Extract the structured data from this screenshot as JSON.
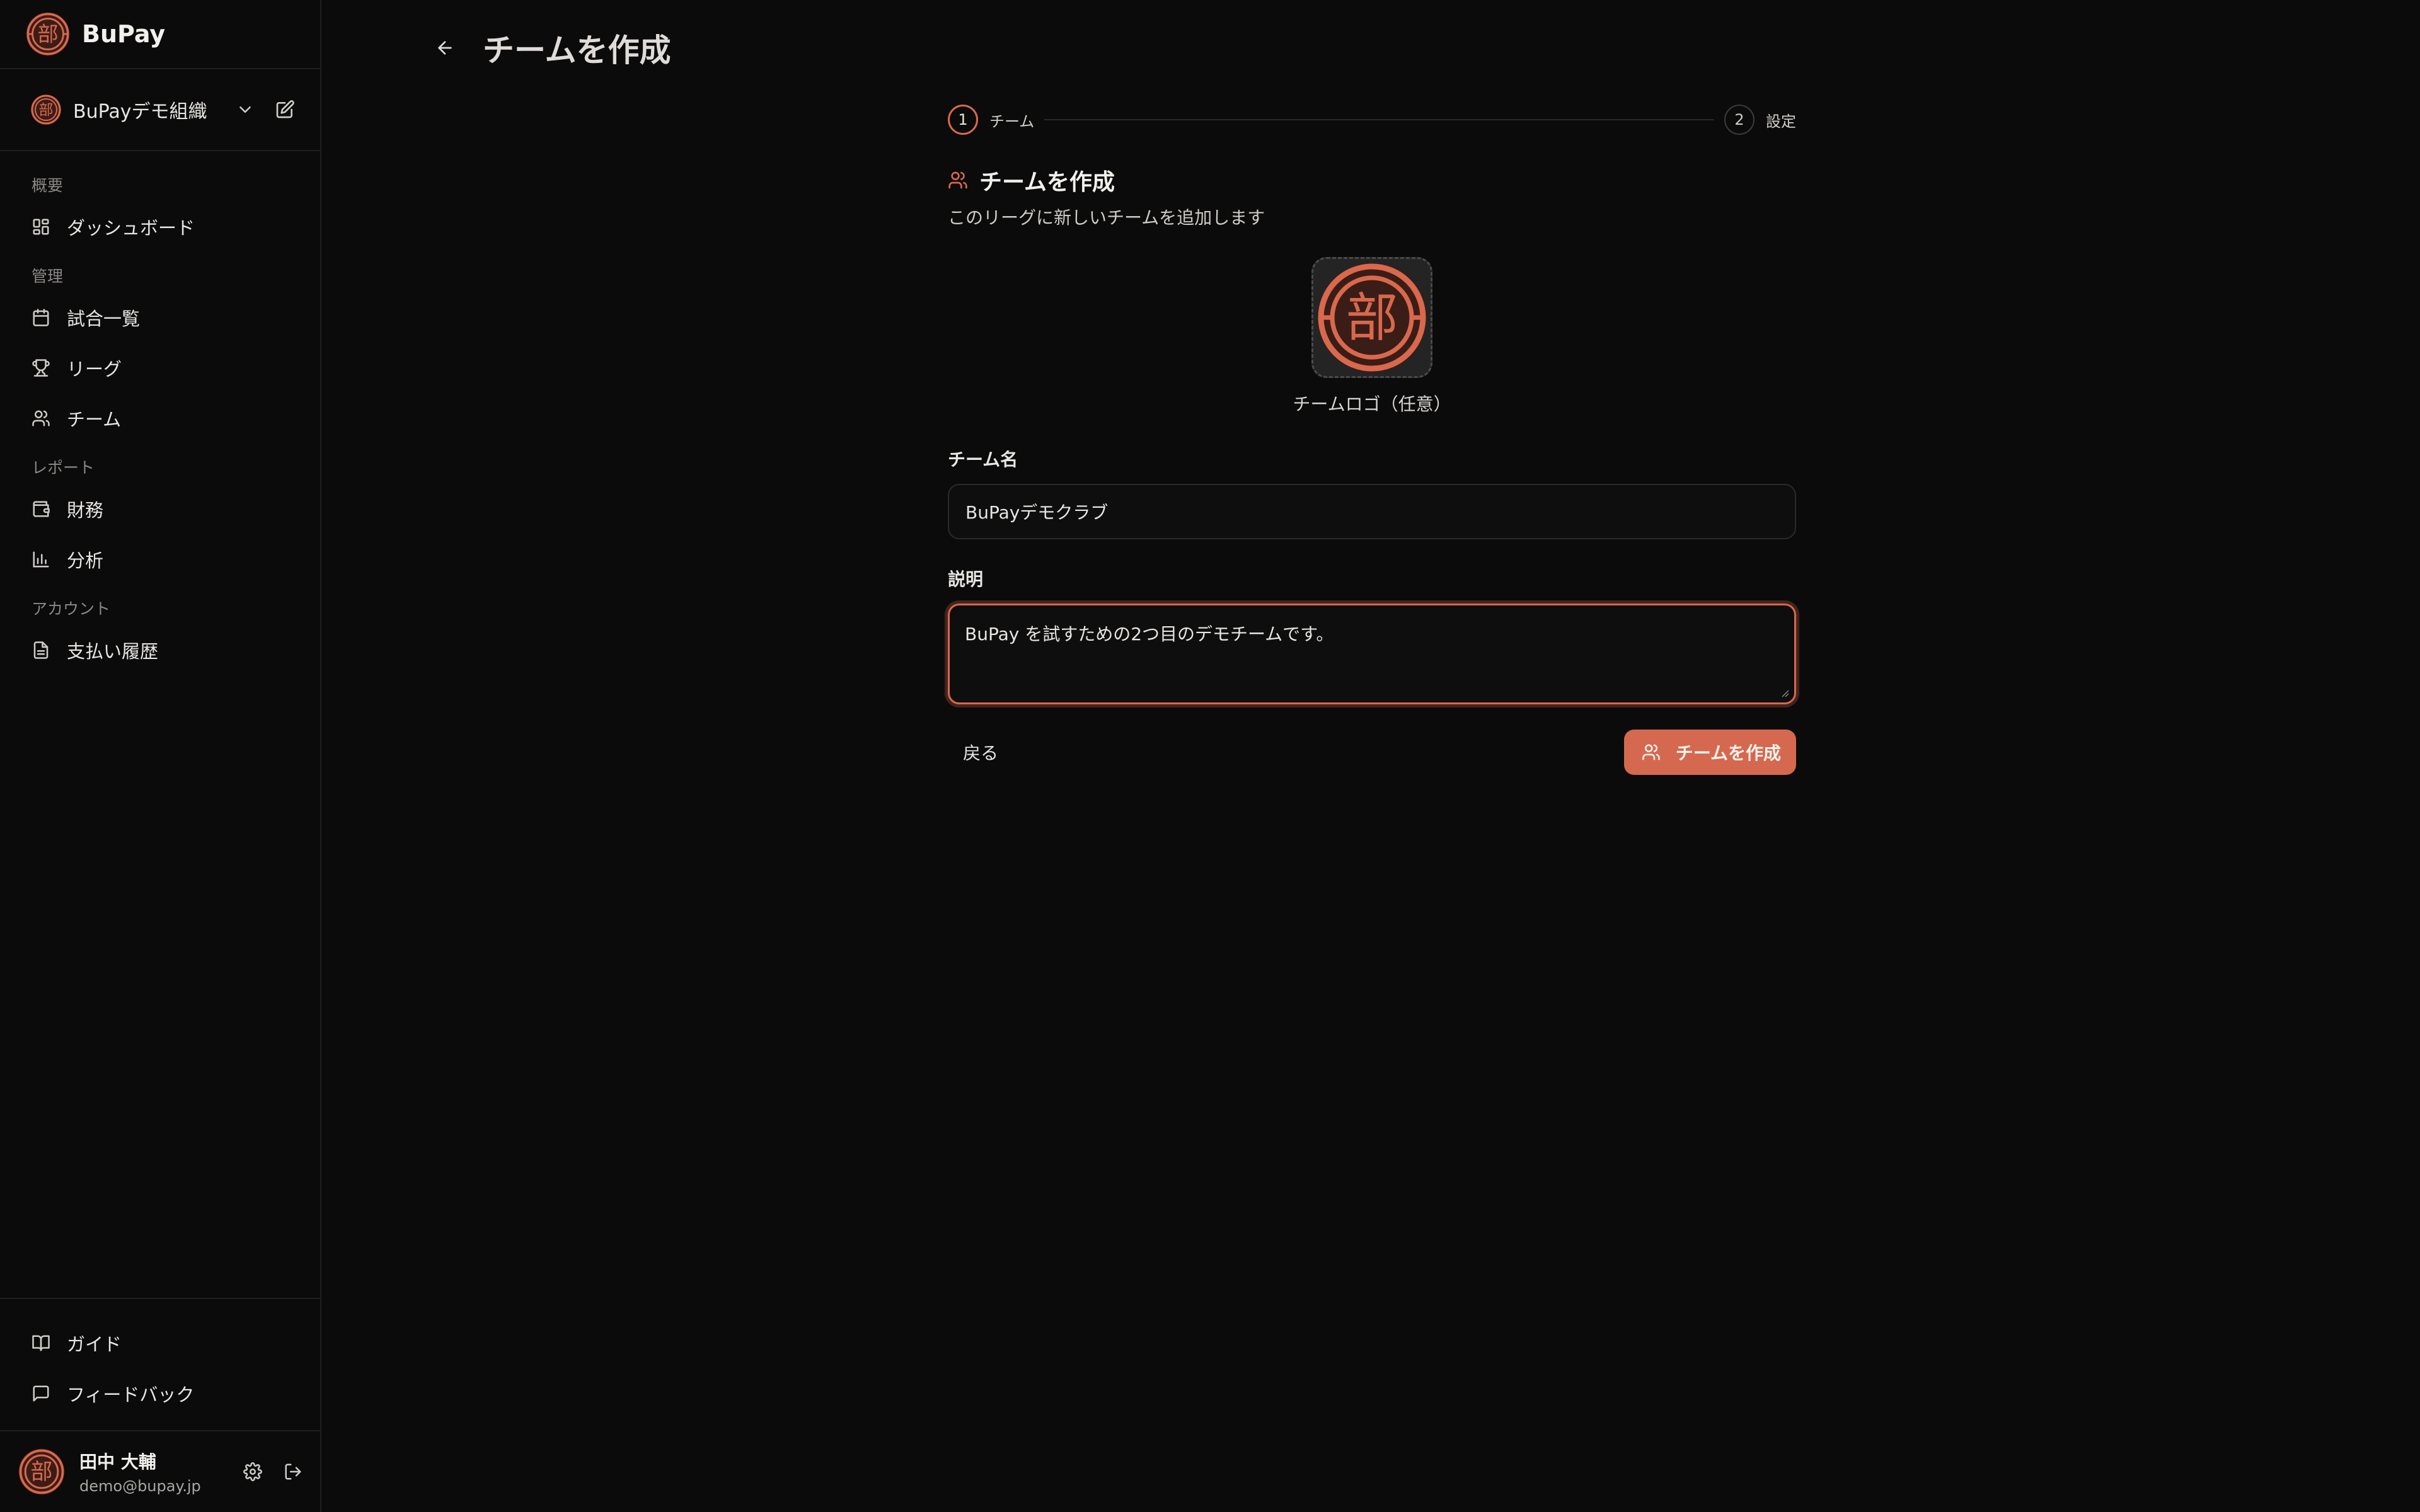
{
  "brand": {
    "name": "BuPay",
    "seal_glyph": "部"
  },
  "org": {
    "name": "BuPayデモ組織"
  },
  "nav": {
    "sections": [
      {
        "title": "概要",
        "items": [
          {
            "label": "ダッシュボード",
            "icon": "dashboard-grid-icon"
          }
        ]
      },
      {
        "title": "管理",
        "items": [
          {
            "label": "試合一覧",
            "icon": "calendar-icon"
          },
          {
            "label": "リーグ",
            "icon": "trophy-icon"
          },
          {
            "label": "チーム",
            "icon": "users-icon"
          }
        ]
      },
      {
        "title": "レポート",
        "items": [
          {
            "label": "財務",
            "icon": "wallet-icon"
          },
          {
            "label": "分析",
            "icon": "bar-chart-icon"
          }
        ]
      },
      {
        "title": "アカウント",
        "items": [
          {
            "label": "支払い履歴",
            "icon": "document-icon"
          }
        ]
      }
    ],
    "bottom": [
      {
        "label": "ガイド",
        "icon": "book-icon"
      },
      {
        "label": "フィードバック",
        "icon": "message-icon"
      }
    ]
  },
  "user": {
    "name": "田中 大輔",
    "email": "demo@bupay.jp"
  },
  "page": {
    "title": "チームを作成"
  },
  "stepper": {
    "steps": [
      {
        "number": "1",
        "label": "チーム",
        "active": true
      },
      {
        "number": "2",
        "label": "設定",
        "active": false
      }
    ]
  },
  "form": {
    "title": "チームを作成",
    "subtitle": "このリーグに新しいチームを追加します",
    "logo_caption": "チームロゴ（任意）",
    "name_label": "チーム名",
    "name_value": "BuPayデモクラブ",
    "description_label": "説明",
    "description_value": "BuPay を試すための2つ目のデモチームです。",
    "back_label": "戻る",
    "submit_label": "チームを作成"
  },
  "colors": {
    "accent": "#d4694f",
    "background": "#0b0b0b",
    "border": "#1f1f1f"
  }
}
